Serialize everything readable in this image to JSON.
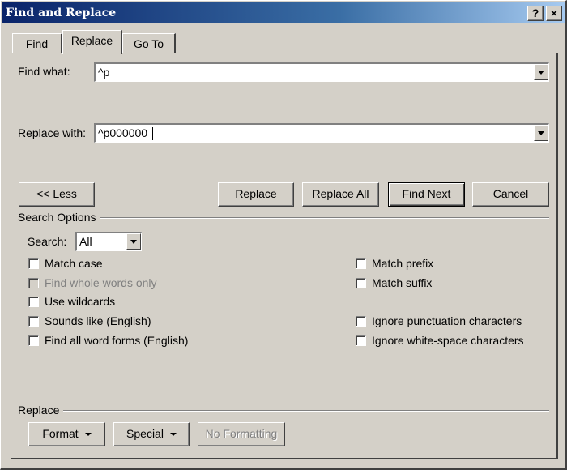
{
  "window": {
    "title": "Find and Replace",
    "help_label": "?",
    "close_label": "×"
  },
  "tabs": [
    {
      "label": "Find"
    },
    {
      "label": "Replace"
    },
    {
      "label": "Go To"
    }
  ],
  "active_tab": "Replace",
  "find": {
    "label": "Find what:",
    "value": "^p"
  },
  "replace": {
    "label": "Replace with:",
    "value": "^p000000 "
  },
  "buttons": {
    "less": "<< Less",
    "replace": "Replace",
    "replace_all": "Replace All",
    "find_next": "Find Next",
    "cancel": "Cancel"
  },
  "search_options": {
    "heading": "Search Options",
    "search_label": "Search:",
    "search_value": "All",
    "left": [
      {
        "label": "Match case",
        "checked": false,
        "enabled": true
      },
      {
        "label": "Find whole words only",
        "checked": false,
        "enabled": false
      },
      {
        "label": "Use wildcards",
        "checked": false,
        "enabled": true
      },
      {
        "label": "Sounds like (English)",
        "checked": false,
        "enabled": true
      },
      {
        "label": "Find all word forms (English)",
        "checked": false,
        "enabled": true
      }
    ],
    "right": [
      {
        "label": "Match prefix",
        "checked": false,
        "enabled": true
      },
      {
        "label": "Match suffix",
        "checked": false,
        "enabled": true
      },
      {
        "label": "Ignore punctuation characters",
        "checked": false,
        "enabled": true
      },
      {
        "label": "Ignore white-space characters",
        "checked": false,
        "enabled": true
      }
    ]
  },
  "replace_section": {
    "heading": "Replace",
    "format": "Format",
    "special": "Special",
    "no_formatting": "No Formatting"
  }
}
